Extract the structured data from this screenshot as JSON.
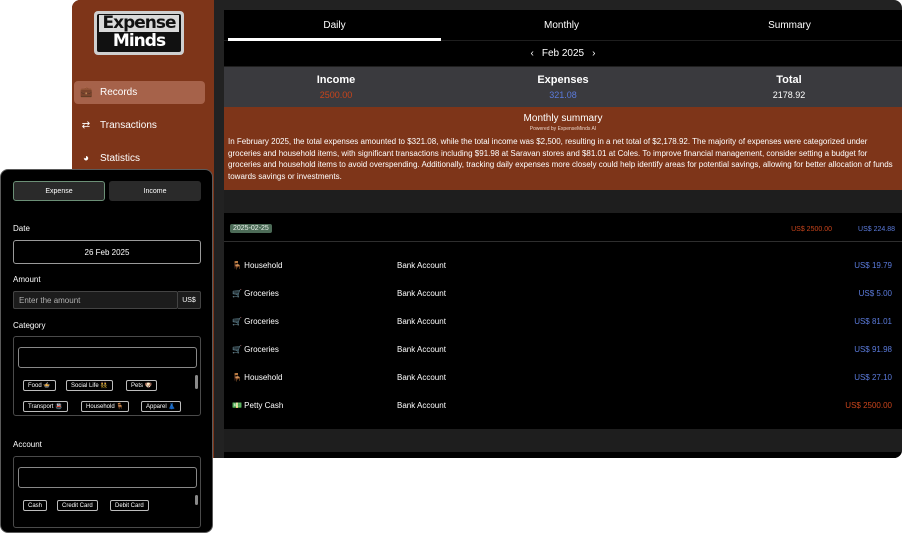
{
  "sidebar": {
    "logo": {
      "line1": "Expense",
      "line2": "Minds"
    },
    "items": [
      {
        "label": "Records",
        "icon": "briefcase-icon",
        "glyph": "💼"
      },
      {
        "label": "Transactions",
        "icon": "swap-arrows-icon",
        "glyph": "⇄"
      },
      {
        "label": "Statistics",
        "icon": "pie-chart-icon",
        "glyph": "◕"
      }
    ]
  },
  "tabs": [
    {
      "label": "Daily"
    },
    {
      "label": "Monthly"
    },
    {
      "label": "Summary"
    }
  ],
  "month_nav": {
    "prev": "‹",
    "label": "Feb 2025",
    "next": "›"
  },
  "totals": {
    "income": {
      "label": "Income",
      "value": "2500.00"
    },
    "expenses": {
      "label": "Expenses",
      "value": "321.08"
    },
    "total": {
      "label": "Total",
      "value": "2178.92"
    }
  },
  "summary": {
    "title": "Monthly summary",
    "subtitle": "Powered by ExpenseMinds AI",
    "text": "In February 2025, the total expenses amounted to $321.08, while the total income was $2,500, resulting in a net total of $2,178.92. The majority of expenses were categorized under groceries and household items, with significant transactions including $91.98 at Saravan stores and $81.01 at Coles. To improve financial management, consider setting a budget for groceries and household items to avoid overspending. Additionally, tracking daily expenses more closely could help identify areas for potential savings, allowing for better allocation of funds towards savings or investments."
  },
  "day": {
    "date": "2025-02-25",
    "income": "US$ 2500.00",
    "expenses": "US$ 224.88",
    "transactions": [
      {
        "category": "🪑 Household",
        "account": "Bank Account",
        "amount": "US$ 19.79",
        "type": "expense"
      },
      {
        "category": "🛒 Groceries",
        "account": "Bank Account",
        "amount": "US$ 5.00",
        "type": "expense"
      },
      {
        "category": "🛒 Groceries",
        "account": "Bank Account",
        "amount": "US$ 81.01",
        "type": "expense"
      },
      {
        "category": "🛒 Groceries",
        "account": "Bank Account",
        "amount": "US$ 91.98",
        "type": "expense"
      },
      {
        "category": "🪑 Household",
        "account": "Bank Account",
        "amount": "US$ 27.10",
        "type": "expense"
      },
      {
        "category": "💵 Petty Cash",
        "account": "Bank Account",
        "amount": "US$ 2500.00",
        "type": "income"
      }
    ]
  },
  "form": {
    "type_tabs": {
      "expense": "Expense",
      "income": "Income"
    },
    "date_label": "Date",
    "date_value": "26 Feb 2025",
    "amount_label": "Amount",
    "amount_placeholder": "Enter the amount",
    "currency": "US$",
    "category_label": "Category",
    "categories": [
      "Food 🍲",
      "Social Life 👯",
      "Pets 🐶",
      "Transport 🚇",
      "Household 🪑",
      "Apparel 👗"
    ],
    "account_label": "Account",
    "accounts": [
      "Cash",
      "Credit Card",
      "Debit Card"
    ]
  },
  "colors": {
    "brand": "#7e3519",
    "income": "#c8441b",
    "expense": "#5b7bdc",
    "active_nav": "#a6624a",
    "date_badge": "#4c6b57"
  }
}
